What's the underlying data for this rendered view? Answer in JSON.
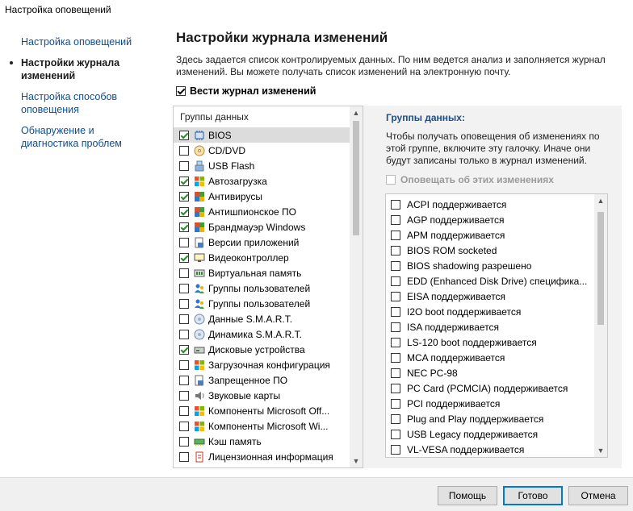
{
  "window": {
    "title": "Настройка оповещений"
  },
  "nav": {
    "items": [
      {
        "label": "Настройка оповещений",
        "active": false
      },
      {
        "label": "Настройки журнала изменений",
        "active": true
      },
      {
        "label": "Настройка способов оповещения",
        "active": false
      },
      {
        "label": "Обнаружение и диагностика проблем",
        "active": false
      }
    ]
  },
  "main": {
    "heading": "Настройки журнала изменений",
    "description": "Здесь задается список контролируемых данных. По ним ведется анализ и заполняется журнал изменений. Вы можете получать список изменений на электронную почту.",
    "log_checkbox": {
      "label": "Вести журнал изменений",
      "checked": true
    }
  },
  "groups_panel": {
    "header": "Группы данных",
    "items": [
      {
        "label": "BIOS",
        "checked": true,
        "icon": "chip-icon",
        "selected": true
      },
      {
        "label": "CD/DVD",
        "checked": false,
        "icon": "disc-icon"
      },
      {
        "label": "USB Flash",
        "checked": false,
        "icon": "usb-icon"
      },
      {
        "label": "Автозагрузка",
        "checked": true,
        "icon": "windows-icon"
      },
      {
        "label": "Антивирусы",
        "checked": true,
        "icon": "shield-icon"
      },
      {
        "label": "Антишпионское ПО",
        "checked": true,
        "icon": "shield-icon"
      },
      {
        "label": "Брандмауэр Windows",
        "checked": true,
        "icon": "shield-icon"
      },
      {
        "label": "Версии приложений",
        "checked": false,
        "icon": "app-icon"
      },
      {
        "label": "Видеоконтроллер",
        "checked": true,
        "icon": "monitor-icon"
      },
      {
        "label": "Виртуальная память",
        "checked": false,
        "icon": "memory-icon"
      },
      {
        "label": "Группы пользователей",
        "checked": false,
        "icon": "users-icon"
      },
      {
        "label": "Группы пользователей",
        "checked": false,
        "icon": "users-icon"
      },
      {
        "label": "Данные S.M.A.R.T.",
        "checked": false,
        "icon": "disk-icon"
      },
      {
        "label": "Динамика S.M.A.R.T.",
        "checked": false,
        "icon": "disk-icon"
      },
      {
        "label": "Дисковые устройства",
        "checked": true,
        "icon": "drive-icon"
      },
      {
        "label": "Загрузочная конфигурация",
        "checked": false,
        "icon": "windows-icon"
      },
      {
        "label": "Запрещенное ПО",
        "checked": false,
        "icon": "app-icon"
      },
      {
        "label": "Звуковые карты",
        "checked": false,
        "icon": "speaker-icon"
      },
      {
        "label": "Компоненты Microsoft Off...",
        "checked": false,
        "icon": "windows-icon"
      },
      {
        "label": "Компоненты Microsoft Wi...",
        "checked": false,
        "icon": "windows-icon"
      },
      {
        "label": "Кэш память",
        "checked": false,
        "icon": "ram-icon"
      },
      {
        "label": "Лицензионная информация",
        "checked": false,
        "icon": "license-icon"
      }
    ]
  },
  "details_panel": {
    "title": "Группы данных:",
    "description": "Чтобы получать оповещения об изменениях по этой группе, включите эту галочку. Иначе они будут записаны только в журнал изменений.",
    "notify": {
      "label": "Оповещать об этих изменениях",
      "checked": false
    },
    "features": [
      "ACPI поддерживается",
      "AGP поддерживается",
      "APM поддерживается",
      "BIOS ROM socketed",
      "BIOS shadowing разрешено",
      "EDD (Enhanced Disk Drive) спецификa...",
      "EISA поддерживается",
      "I2O boot поддерживается",
      "ISA поддерживается",
      "LS-120 boot поддерживается",
      "MCA поддерживается",
      "NEC PC-98",
      "PC Card (PCMCIA) поддерживается",
      "PCI поддерживается",
      "Plug and Play поддерживается",
      "USB Legacy поддерживается",
      "VL-VESA поддерживается"
    ]
  },
  "footer": {
    "help": "Помощь",
    "ok": "Готово",
    "cancel": "Отмена"
  },
  "colors": {
    "link": "#0a4f96",
    "accent": "#0078d7",
    "check_green": "#2a8a2a"
  }
}
